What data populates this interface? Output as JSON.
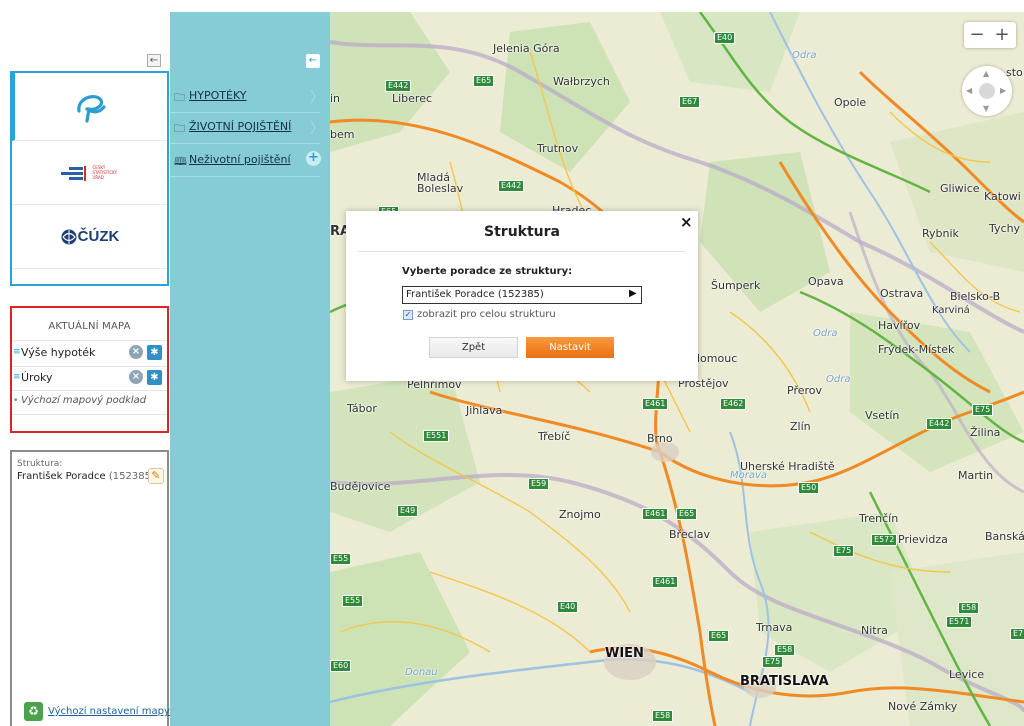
{
  "left_panel": {
    "collapse_icon": "←",
    "logos": [
      {
        "name": "e-logo",
        "text": ""
      },
      {
        "name": "csu-logo",
        "text": "ČESKÝ STATISTICKÝ ÚŘAD"
      },
      {
        "name": "cuzk-logo",
        "text": "ČÚZK"
      }
    ],
    "current_map": {
      "title": "AKTUÁLNÍ MAPA",
      "layers": [
        {
          "label": "Výše hypoték"
        },
        {
          "label": "Úroky"
        }
      ],
      "base_layer": "Výchozí mapový podklad"
    },
    "structure": {
      "label": "Struktura:",
      "name": "František Poradce",
      "id": "(152385)"
    },
    "reset_label": "Výchozí nastavení mapy"
  },
  "nav_panel": {
    "collapse_icon": "←",
    "items": [
      {
        "label": "HYPOTÉKY",
        "icon": "folder-icon"
      },
      {
        "label": "ŽIVOTNÍ POJIŠTĚNÍ",
        "icon": "folder-icon"
      },
      {
        "label": "Neživotní pojištění",
        "icon": "map-icon"
      }
    ]
  },
  "map": {
    "zoom_out": "−",
    "zoom_in": "+",
    "labels": {
      "jelenia_gora": "Jelenia Góra",
      "walbrzych": "Wałbrzych",
      "liberec": "Liberec",
      "opole": "Opole",
      "trutnov": "Trutnov",
      "mlada_boleslav": "Mladá Boleslav",
      "hradec": "Hradec",
      "gliwice": "Gliwice",
      "katowice": "Katowi",
      "rybnik": "Rybnik",
      "tychy": "Tychy",
      "sumperk": "Šumperk",
      "opava": "Opava",
      "ostrava": "Ostrava",
      "bielsko": "Bielsko-B",
      "karvina": "Karviná",
      "havirov": "Havířov",
      "frydek": "Frýdek-Místek",
      "olomouc": "lomouc",
      "prostejov": "Prostějov",
      "prerov": "Přerov",
      "pelhrimov": "Pelhřimov",
      "tabor": "Tábor",
      "jihlava": "Jihlava",
      "vsetin": "Vsetín",
      "zlin": "Zlín",
      "zilina": "Žilina",
      "trebic": "Třebíč",
      "brno": "Brno",
      "uherske": "Uherské Hradiště",
      "martin": "Martin",
      "budejovice": "Budějovice",
      "znojmo": "Znojmo",
      "breclav": "Břeclav",
      "trencin": "Trenčín",
      "prievidza": "Prievidza",
      "banska": "Banská",
      "trnava": "Trnava",
      "nitra": "Nitra",
      "wien": "WIEN",
      "bratislava": "BRATISLAVA",
      "levice": "Levice",
      "nove_zamky": "Nové Zámky",
      "odra1": "Odra",
      "odra2": "Odra",
      "odra3": "Odra",
      "morava": "Morava",
      "donau": "Donau",
      "sto": "sto",
      "ra": "RA",
      "bem": "bem",
      "in": "in"
    },
    "roads": [
      "E40",
      "E442",
      "E65",
      "E67",
      "E442",
      "E65",
      "E461",
      "E462",
      "E75",
      "E442",
      "E551",
      "E59",
      "E50",
      "E49",
      "E461",
      "E65",
      "E55",
      "E75",
      "E572",
      "E461",
      "E55",
      "E40",
      "E58",
      "E571",
      "E65",
      "E58",
      "E75",
      "E60",
      "E58",
      "E7"
    ]
  },
  "dialog": {
    "close": "×",
    "title": "Struktura",
    "prompt": "Vyberte poradce ze struktury:",
    "selected": "František Poradce (152385)",
    "checkbox_label": "zobrazit pro celou strukturu",
    "back_label": "Zpět",
    "submit_label": "Nastavit"
  }
}
